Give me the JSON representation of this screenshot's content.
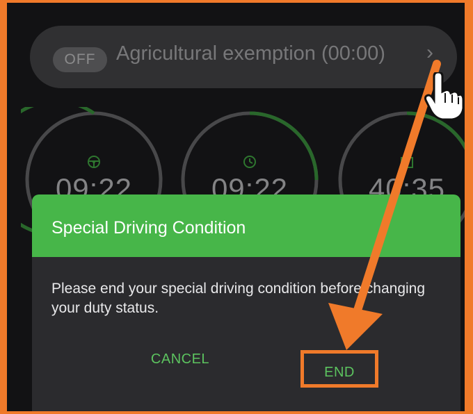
{
  "exemption": {
    "status": "OFF",
    "label": "Agricultural exemption (00:00)",
    "chevron": "›"
  },
  "gauges": [
    {
      "icon": "steering-wheel-icon",
      "time": "09:22"
    },
    {
      "icon": "clock-icon",
      "time": "09:22"
    },
    {
      "icon": "calendar-icon",
      "time": "40:35"
    }
  ],
  "dialog": {
    "title": "Special Driving Condition",
    "message": "Please end your special driving condition before changing your duty status.",
    "cancel_label": "CANCEL",
    "end_label": "END"
  },
  "colors": {
    "accent_green": "#47b649",
    "highlight_orange": "#f07a2a",
    "background": "#1d1d1f"
  }
}
